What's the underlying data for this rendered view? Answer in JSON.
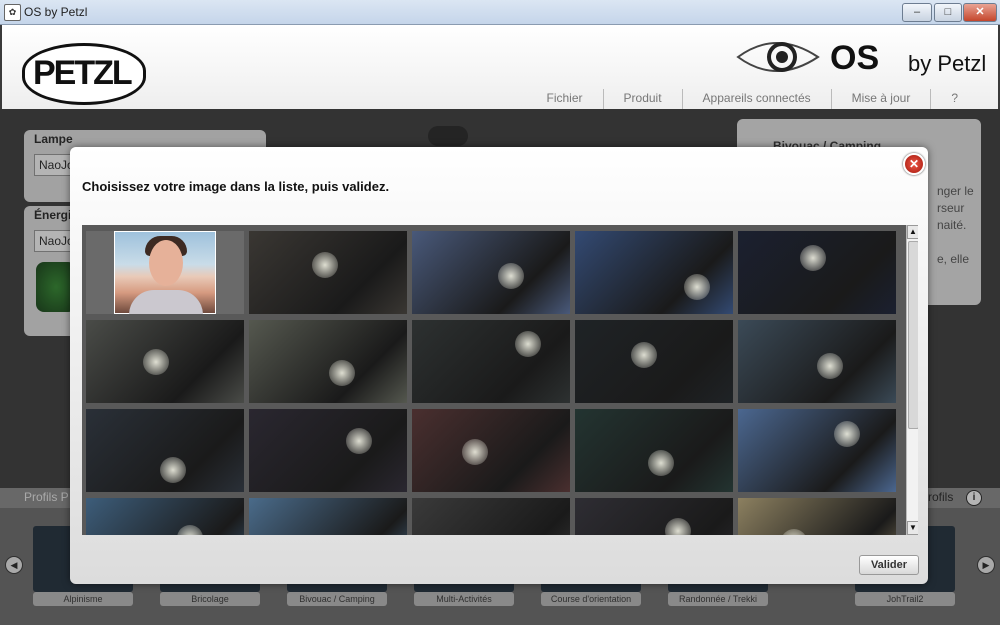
{
  "window": {
    "title": "OS by Petzl",
    "minimize": "–",
    "maximize": "□",
    "close": "✕",
    "app_icon": "✿"
  },
  "header": {
    "brand": "PETZL",
    "os_logo": "OS",
    "os_by": "by Petzl",
    "menu": [
      "Fichier",
      "Produit",
      "Appareils connectés",
      "Mise à jour",
      "?"
    ]
  },
  "left_panel": {
    "lamp_label": "Lampe",
    "lamp_value": "NaoJo",
    "energy_label": "Énergi",
    "energy_value": "NaoJo"
  },
  "right_panel": {
    "title": "Bivouac / Camping",
    "text": "nger le\nrseur\nnaité.\n\ne, elle"
  },
  "profiles": {
    "left_label": "Profils P",
    "right_label": "rofils",
    "info": "i",
    "items": [
      "Alpinisme",
      "Bricolage",
      "Bivouac / Camping",
      "Multi-Activités",
      "Course d'orientation",
      "Randonnée / Trekki",
      "JohTrail2"
    ],
    "prev": "◀",
    "next": "▶"
  },
  "modal": {
    "title": "Choisissez votre image dans la liste, puis validez.",
    "close": "✕",
    "validate": "Valider",
    "scroll_up": "▲",
    "scroll_down": "▼",
    "image_colors": [
      [
        "#6a7f95",
        "#3a3733",
        "#49597a",
        "#334a73",
        "#1b2030"
      ],
      [
        "#4a4c48",
        "#55584f",
        "#2d3131",
        "#1f2326",
        "#3b4a57"
      ],
      [
        "#2a3038",
        "#2a2730",
        "#4a2f2f",
        "#233431",
        "#4b6790"
      ],
      [
        "#3d5d7a",
        "#4a6b8a",
        "#3a3a3a",
        "#2e2d33",
        "#8c8060"
      ]
    ]
  }
}
